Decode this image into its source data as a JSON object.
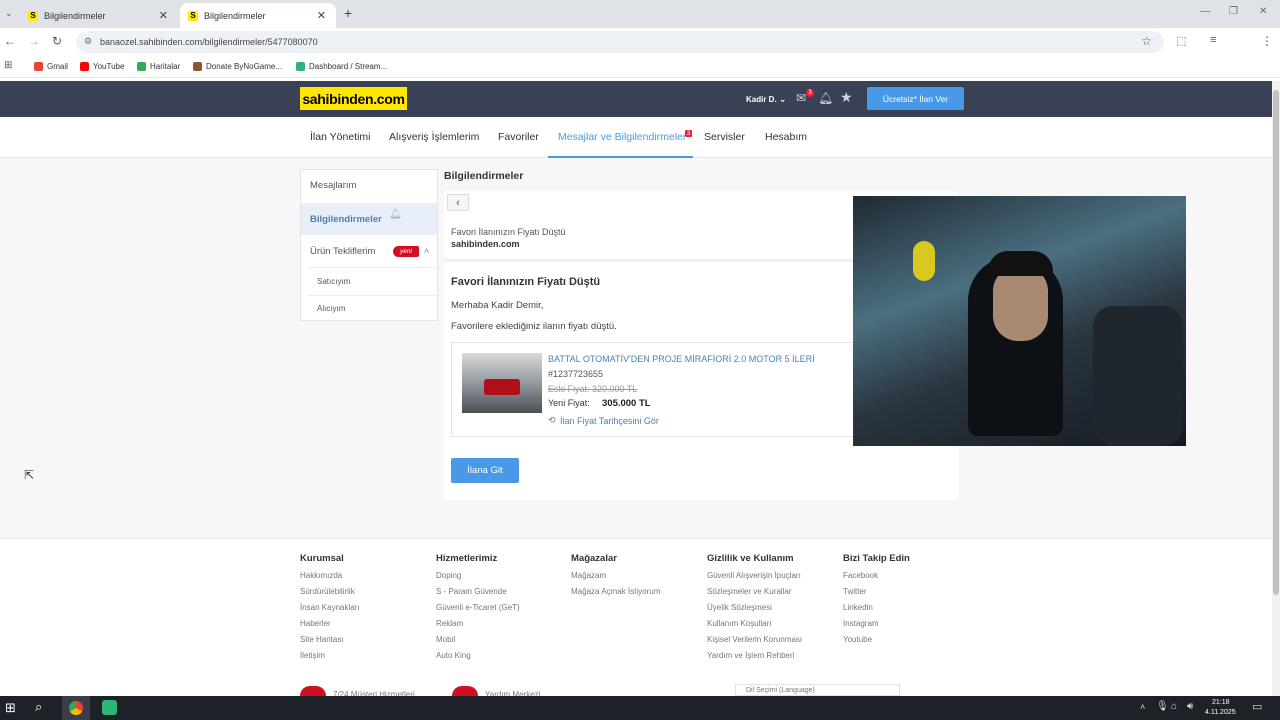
{
  "browser": {
    "tabs": [
      {
        "title": "Bilgilendirmeler",
        "favicon": "S"
      },
      {
        "title": "Bilgilendirmeler",
        "favicon": "S"
      }
    ],
    "url": "banaozel.sahibinden.com/bilgilendirmeler/5477080070",
    "bookmarks": [
      "Gmail",
      "YouTube",
      "Haritalar",
      "Donate ByNoGame...",
      "Dashboard / Stream..."
    ]
  },
  "header": {
    "logo": "sahibinden.com",
    "user": "Kadir D.",
    "message_badge": "3",
    "cta": "Ücretsiz* İlan Ver"
  },
  "nav": {
    "items": [
      "İlan Yönetimi",
      "Alışveriş İşlemlerim",
      "Favoriler",
      "Mesajlar ve Bilgilendirmeler",
      "Servisler",
      "Hesabım"
    ],
    "badge": "3"
  },
  "sidebar": {
    "messages": "Mesajlarım",
    "notifications": "Bilgilendirmeler",
    "offers": "Ürün Tekliflerim",
    "new_tag": "yeni",
    "seller": "Satıcıyım",
    "buyer": "Alıcıyım"
  },
  "content": {
    "page_title": "Bilgilendirmeler",
    "meta_title": "Favori İlanınızın Fiyatı Düştü",
    "meta_sender": "sahibinden.com",
    "heading": "Favori İlanınızın Fiyatı Düştü",
    "greeting": "Merhaba Kadir Demir,",
    "body": "Favorilere eklediğiniz ilanın fiyatı düştü.",
    "listing": {
      "title": "BATTAL OTOMATİV'DEN PROJE MİRAFİORİ 2.0 MOTOR 5 İLERİ",
      "id": "#1237723655",
      "old_price": "Eski Fiyat: 320.000 TL",
      "new_price_label": "Yeni Fiyat:",
      "new_price": "305.000 TL",
      "history_link": "İlan Fiyat Tarihçesini Gör"
    },
    "button": "İlana Git"
  },
  "footer": {
    "columns": [
      {
        "title": "Kurumsal",
        "items": [
          "Hakkımızda",
          "Sürdürülebilirlik",
          "İnsan Kaynakları",
          "Haberler",
          "Site Haritası",
          "İletişim"
        ]
      },
      {
        "title": "Hizmetlerimiz",
        "items": [
          "Doping",
          "S - Param Güvende",
          "Güvenli e-Ticaret (GeT)",
          "Reklam",
          "Mobil",
          "Auto King"
        ]
      },
      {
        "title": "Mağazalar",
        "items": [
          "Mağazam",
          "Mağaza Açmak İstiyorum"
        ]
      },
      {
        "title": "Gizlilik ve Kullanım",
        "items": [
          "Güvenli Alışverişin İpuçları",
          "Sözleşmeler ve Kurallar",
          "Üyelik Sözleşmesi",
          "Kullanım Koşulları",
          "Kişisel Verilerin Korunması",
          "Yardım ve İşlem Rehberi"
        ]
      },
      {
        "title": "Bizi Takip Edin",
        "items": [
          "Facebook",
          "Twitter",
          "Linkedin",
          "Instagram",
          "Youtube"
        ]
      }
    ],
    "support": "7/24 Müşteri Hizmetleri",
    "help": "Yardım Merkezi",
    "language": "Dil Seçimi (Language)"
  },
  "taskbar": {
    "time": "21:18",
    "date": "4.11.2025"
  },
  "colors": {
    "header_bg": "#3b4155",
    "logo_bg": "#ffe800",
    "accent": "#489ae9",
    "link": "#4a7fb8"
  }
}
